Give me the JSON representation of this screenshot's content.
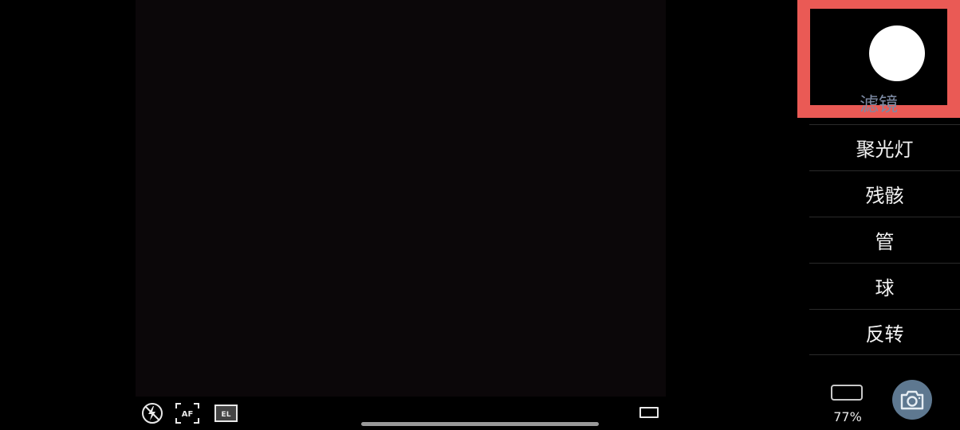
{
  "filter_panel": {
    "selected_label": "滤镜",
    "items": [
      {
        "label": "聚光灯"
      },
      {
        "label": "残骸"
      },
      {
        "label": "管"
      },
      {
        "label": "球"
      },
      {
        "label": "反转"
      }
    ]
  },
  "status": {
    "battery_level": "77%"
  },
  "bottom_bar": {
    "af_label": "AF",
    "el_label": "EL"
  },
  "icons": {
    "flash": "flash-off-icon",
    "af": "autofocus-icon",
    "el": "exposure-lock-icon",
    "aspect": "aspect-ratio-icon",
    "battery": "battery-icon",
    "shutter": "camera-icon"
  },
  "colors": {
    "highlight_border": "#ea5a55",
    "selected_label": "#7d8aa3",
    "shutter_bg": "#5e7890"
  }
}
